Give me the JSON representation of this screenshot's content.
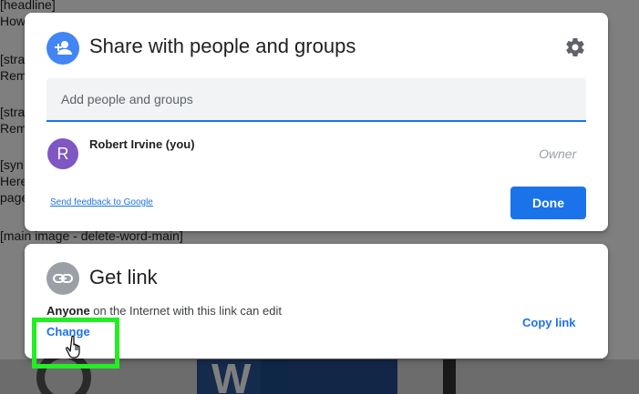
{
  "background": {
    "lines": [
      "[headline]",
      "How",
      "[stra",
      "Rem",
      "[stra",
      "Rem",
      "[syn",
      "Here",
      "page",
      "[main image - delete-word-main]"
    ],
    "image_letter": "W"
  },
  "share_dialog": {
    "title": "Share with people and groups",
    "icons": {
      "header": "person-add-icon",
      "settings": "gear-icon"
    },
    "input": {
      "placeholder": "Add people and groups",
      "value": ""
    },
    "person": {
      "avatar_letter": "R",
      "avatar_color": "#7e57c2",
      "name": "Robert Irvine (you)",
      "role": "Owner"
    },
    "feedback_label": "Send feedback to Google",
    "done_label": "Done"
  },
  "get_link": {
    "title": "Get link",
    "icon": "link-icon",
    "description_bold": "Anyone",
    "description_rest": " on the Internet with this link can edit",
    "change_label": "Change",
    "copy_label": "Copy link"
  },
  "colors": {
    "accent": "#1a73e8",
    "highlight": "#22ee22",
    "header_icon_bg": "#4285f4",
    "link_icon_bg": "#9aa0a6"
  }
}
